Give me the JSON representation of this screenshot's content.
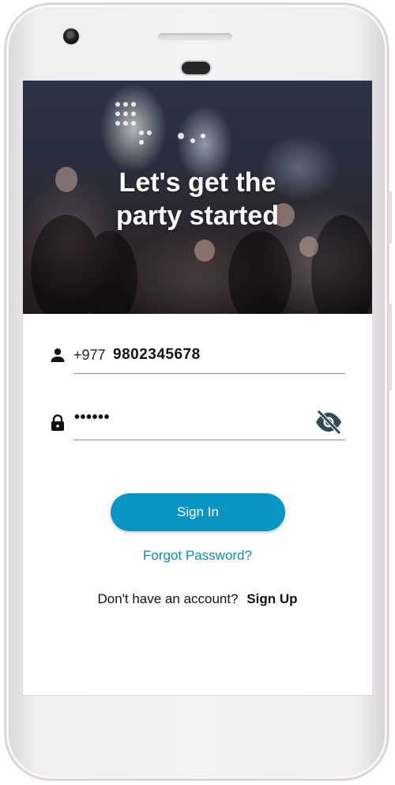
{
  "hero": {
    "title_line1": "Let's get the",
    "title_line2": "party started"
  },
  "login": {
    "phone_prefix": "+977",
    "phone_number": "9802345678",
    "password_masked": "••••••",
    "signin_label": "Sign In",
    "forgot_label": "Forgot Password?",
    "no_account_text": "Don't have an account?",
    "signup_label": "Sign Up"
  },
  "colors": {
    "accent": "#0a96c4",
    "link": "#0a8cbf",
    "text": "#111111"
  },
  "icons": {
    "user": "person-icon",
    "lock": "lock-icon",
    "visibility": "eye-off-icon"
  }
}
